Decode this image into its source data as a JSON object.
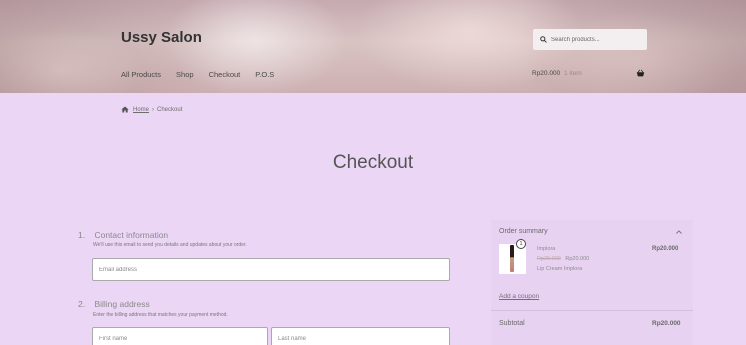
{
  "header": {
    "site_title": "Ussy Salon",
    "nav": [
      "All Products",
      "Shop",
      "Checkout",
      "P.O.S"
    ],
    "search_placeholder": "Search products...",
    "cart_total": "Rp20.000",
    "cart_items": "1 item",
    "icons": {
      "search": "search-icon",
      "basket": "basket-icon"
    }
  },
  "breadcrumb": {
    "home": "Home",
    "separator": "›",
    "current": "Checkout"
  },
  "page_title": "Checkout",
  "checkout": {
    "contact": {
      "number": "1.",
      "title": "Contact information",
      "description": "We'll use this email to send you details and updates about your order.",
      "email_placeholder": "Email address"
    },
    "billing": {
      "number": "2.",
      "title": "Billing address",
      "description": "Enter the billing address that matches your payment method.",
      "first_name_placeholder": "First name",
      "last_name_placeholder": "Last name"
    }
  },
  "order_summary": {
    "title": "Order summary",
    "item": {
      "quantity": "1",
      "name": "Implora",
      "price_old": "Rp25.000",
      "price_new": "Rp20.000",
      "description": "Lip Cream Implora",
      "total": "Rp20.000"
    },
    "coupon_link": "Add a coupon",
    "subtotal_label": "Subtotal",
    "subtotal_value": "Rp20.000"
  },
  "colors": {
    "page_background": "#ecd6f5",
    "field_border": "#a9a9a9",
    "text": "#6a6a6a"
  }
}
